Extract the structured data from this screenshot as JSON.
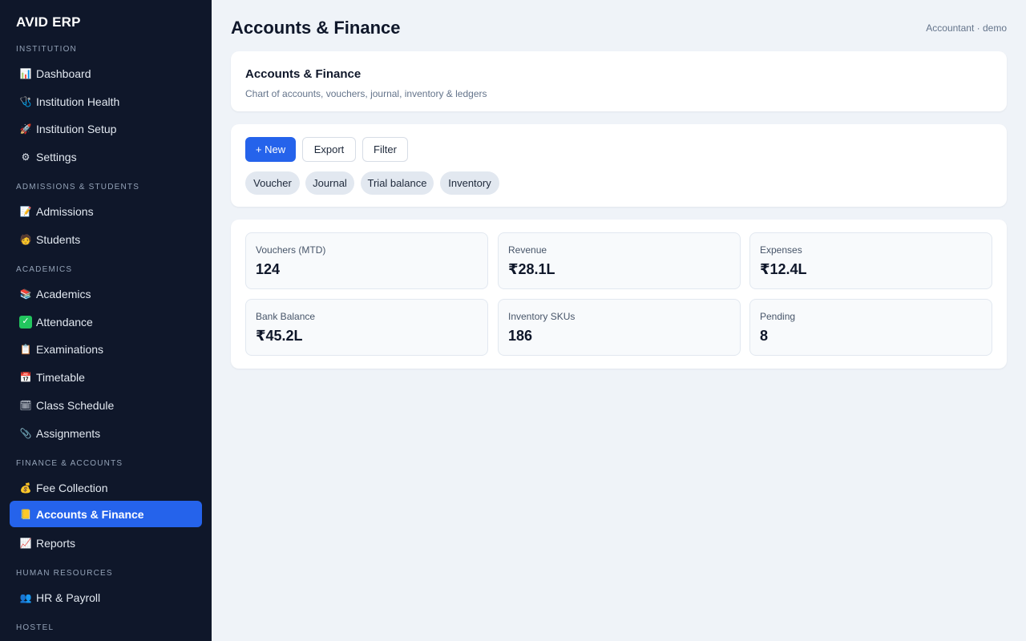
{
  "app": {
    "brand": "AVID ERP"
  },
  "header": {
    "title": "Accounts & Finance",
    "user": "Accountant · demo"
  },
  "sidebar": {
    "sections": [
      {
        "label": "INSTITUTION"
      },
      {
        "label": "ADMISSIONS & STUDENTS"
      },
      {
        "label": "ACADEMICS"
      },
      {
        "label": "FINANCE & ACCOUNTS"
      },
      {
        "label": "HUMAN RESOURCES"
      },
      {
        "label": "HOSTEL"
      }
    ],
    "items": [
      {
        "label": "Dashboard",
        "icon": "bar-chart-icon",
        "glyph": "📊"
      },
      {
        "label": "Institution Health",
        "icon": "stethoscope-icon",
        "glyph": "🩺"
      },
      {
        "label": "Institution Setup",
        "icon": "rocket-icon",
        "glyph": "🚀"
      },
      {
        "label": "Settings",
        "icon": "gear-icon",
        "glyph": "⚙"
      },
      {
        "label": "Admissions",
        "icon": "memo-icon",
        "glyph": "📝"
      },
      {
        "label": "Students",
        "icon": "student-icon",
        "glyph": "🧑"
      },
      {
        "label": "Academics",
        "icon": "books-icon",
        "glyph": "📚"
      },
      {
        "label": "Attendance",
        "icon": "check-icon",
        "glyph": "✓"
      },
      {
        "label": "Examinations",
        "icon": "clipboard-icon",
        "glyph": "📋"
      },
      {
        "label": "Timetable",
        "icon": "calendar-icon",
        "glyph": "📅"
      },
      {
        "label": "Class Schedule",
        "icon": "spiral-calendar-icon",
        "glyph": "🗓"
      },
      {
        "label": "Assignments",
        "icon": "paperclip-icon",
        "glyph": "📎"
      },
      {
        "label": "Fee Collection",
        "icon": "money-bag-icon",
        "glyph": "💰"
      },
      {
        "label": "Accounts & Finance",
        "icon": "ledger-icon",
        "glyph": "📒",
        "active": true
      },
      {
        "label": "Reports",
        "icon": "chart-up-icon",
        "glyph": "📈"
      },
      {
        "label": "HR & Payroll",
        "icon": "people-icon",
        "glyph": "👥"
      }
    ]
  },
  "intro": {
    "title": "Accounts & Finance",
    "subtitle": "Chart of accounts, vouchers, journal, inventory & ledgers"
  },
  "toolbar": {
    "new_label": "+ New",
    "export_label": "Export",
    "filter_label": "Filter",
    "chips": [
      "Voucher",
      "Journal",
      "Trial balance",
      "Inventory"
    ]
  },
  "stats": [
    {
      "label": "Vouchers (MTD)",
      "value": "124"
    },
    {
      "label": "Revenue",
      "value": "₹28.1L"
    },
    {
      "label": "Expenses",
      "value": "₹12.4L"
    },
    {
      "label": "Bank Balance",
      "value": "₹45.2L"
    },
    {
      "label": "Inventory SKUs",
      "value": "186"
    },
    {
      "label": "Pending",
      "value": "8"
    }
  ],
  "colors": {
    "sidebar_bg": "#0f172a",
    "accent": "#2563eb",
    "page_bg": "#eff3f8"
  }
}
